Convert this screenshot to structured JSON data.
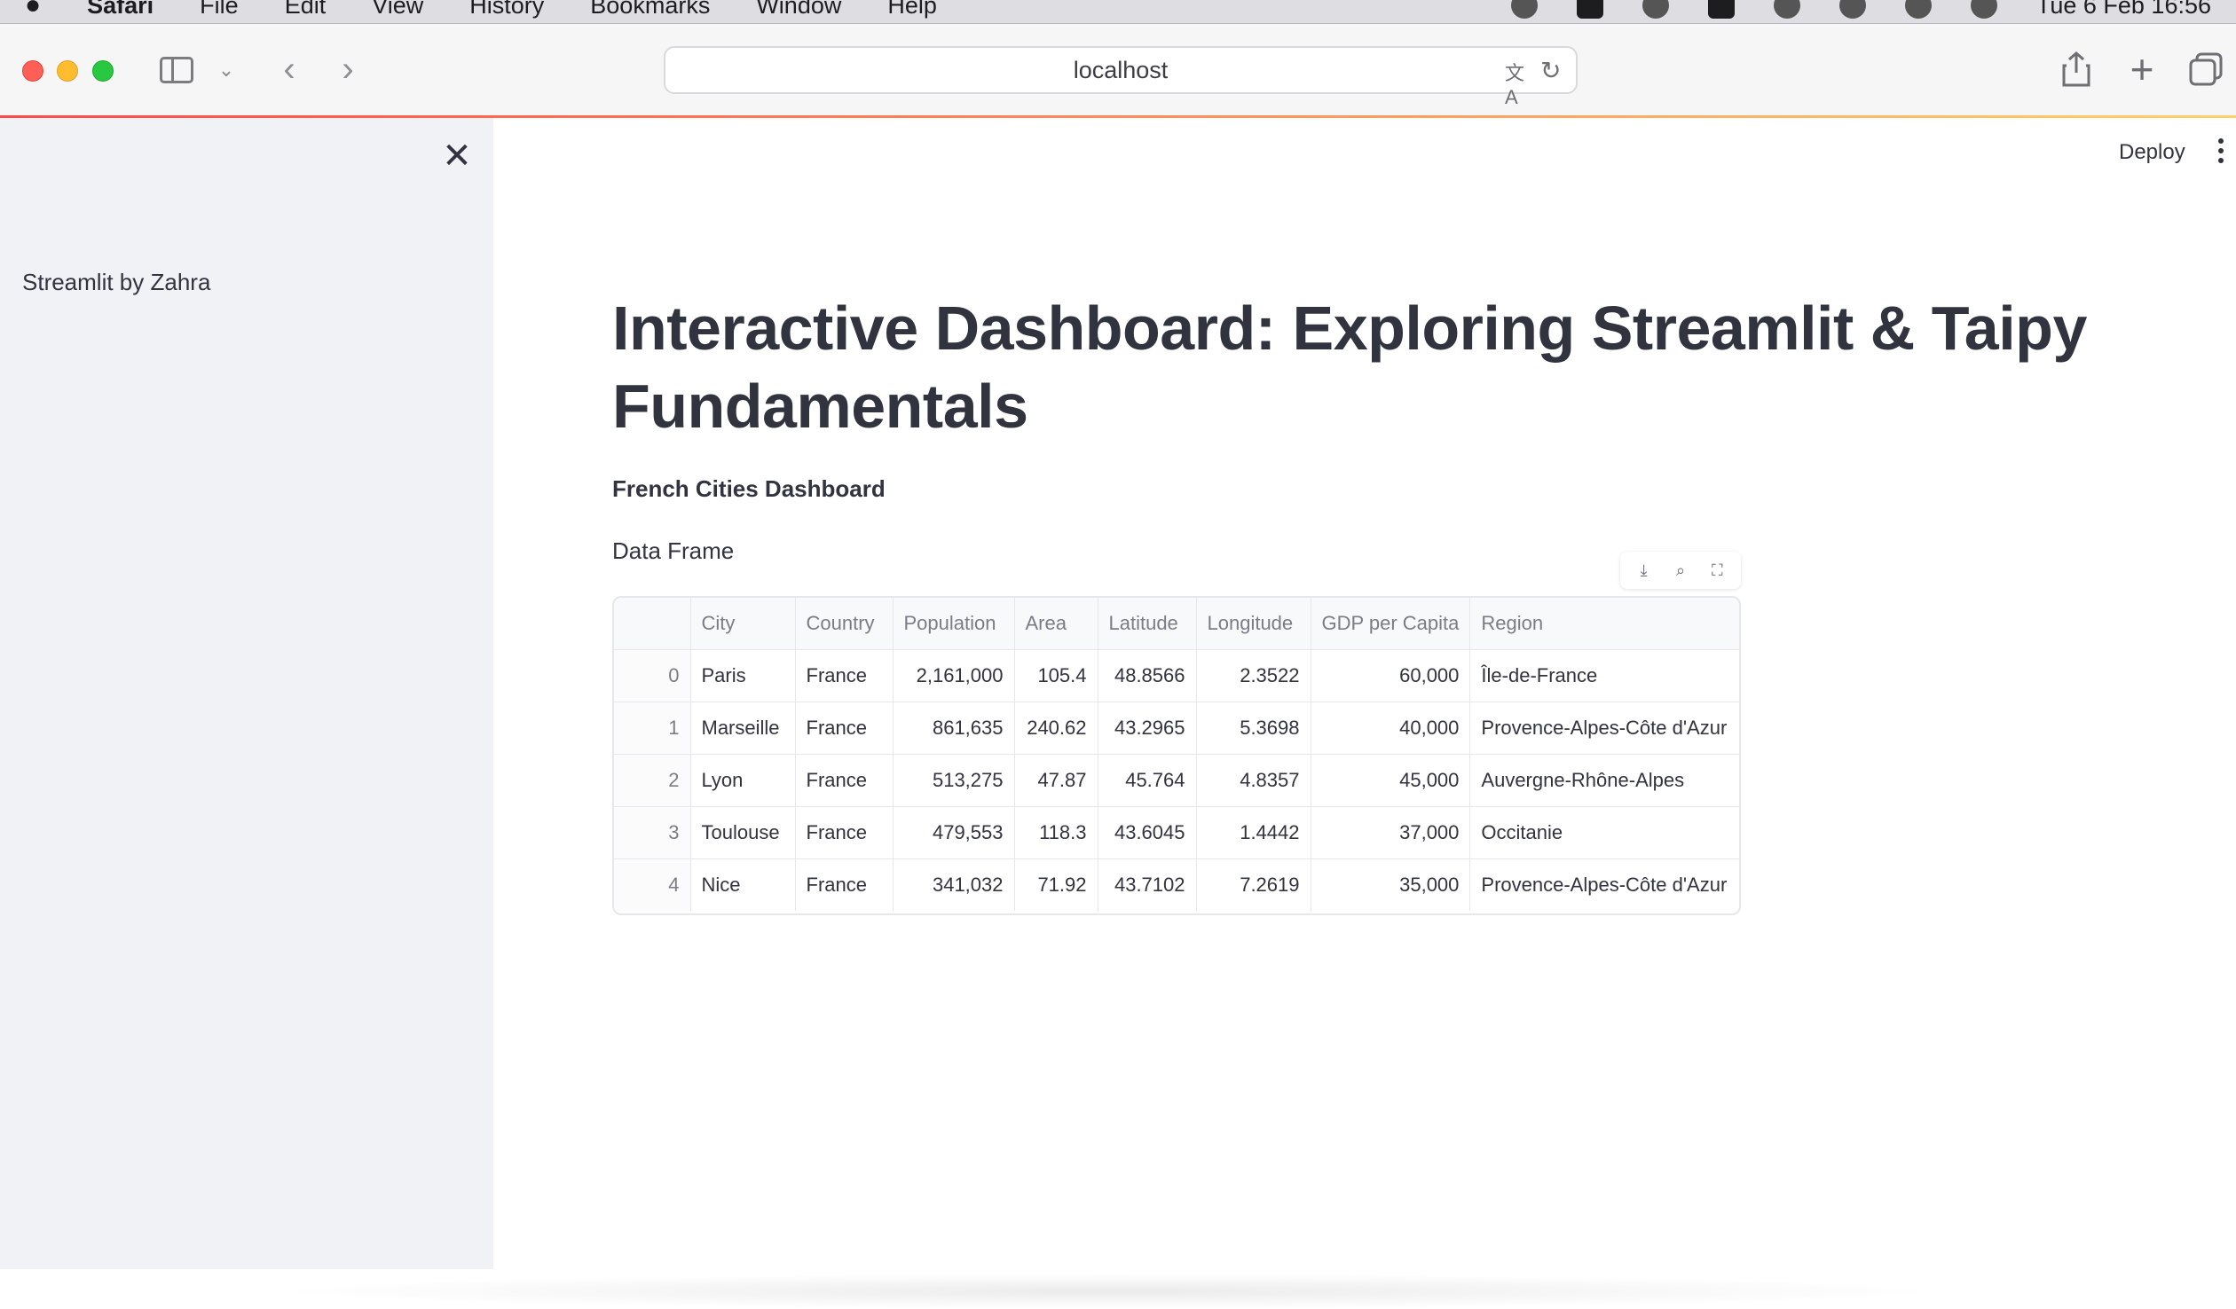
{
  "menubar": {
    "app": "Safari",
    "items": [
      "File",
      "Edit",
      "View",
      "History",
      "Bookmarks",
      "Window",
      "Help"
    ],
    "clock": "Tue 6 Feb 16:56"
  },
  "browser": {
    "url": "localhost"
  },
  "sidebar": {
    "text": "Streamlit by Zahra",
    "close": "✕"
  },
  "header": {
    "deploy": "Deploy"
  },
  "main": {
    "title": "Interactive Dashboard: Exploring Streamlit & Taipy Fundamentals",
    "subheader": "French Cities Dashboard",
    "df_label": "Data Frame",
    "table": {
      "columns": [
        "",
        "City",
        "Country",
        "Population",
        "Area",
        "Latitude",
        "Longitude",
        "GDP per Capita",
        "Region"
      ],
      "rows": [
        [
          "0",
          "Paris",
          "France",
          "2,161,000",
          "105.4",
          "48.8566",
          "2.3522",
          "60,000",
          "Île-de-France"
        ],
        [
          "1",
          "Marseille",
          "France",
          "861,635",
          "240.62",
          "43.2965",
          "5.3698",
          "40,000",
          "Provence-Alpes-Côte d'Azur"
        ],
        [
          "2",
          "Lyon",
          "France",
          "513,275",
          "47.87",
          "45.764",
          "4.8357",
          "45,000",
          "Auvergne-Rhône-Alpes"
        ],
        [
          "3",
          "Toulouse",
          "France",
          "479,553",
          "118.3",
          "43.6045",
          "1.4442",
          "37,000",
          "Occitanie"
        ],
        [
          "4",
          "Nice",
          "France",
          "341,032",
          "71.92",
          "43.7102",
          "7.2619",
          "35,000",
          "Provence-Alpes-Côte d'Azur"
        ]
      ]
    }
  },
  "colors": {
    "accent": "#ff4b4b",
    "sidebar_bg": "#f0f2f6",
    "text": "#31333f"
  }
}
